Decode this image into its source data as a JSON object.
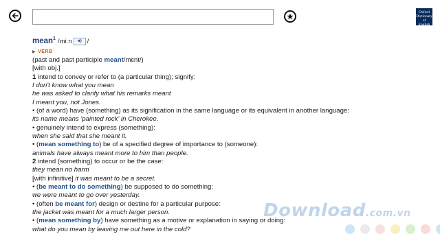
{
  "toolbar": {
    "back_icon": "back-arrow-icon",
    "favorite_icon": "star-icon",
    "search_value": "",
    "search_placeholder": ""
  },
  "logo": {
    "line1": "Oxford",
    "line2": "Dictionary of",
    "line3": "English"
  },
  "entry": {
    "headword": "mean",
    "homograph": "1",
    "pron_open": "/miːn",
    "pron_close": "/",
    "audio_icon": "speaker-icon",
    "pos": "VERB",
    "forms_pre": "(past and past participle ",
    "forms_word": "meant",
    "forms_post": "/mɛnt/)",
    "grammar": "[with obj.]",
    "l1_num": "1",
    "l1_text": " intend to convey or refer to (a particular thing); signify:",
    "l2": "I don't know what you mean",
    "l3": "he was asked to clarify what his remarks meant",
    "l4": "I meant you, not Jones.",
    "l5": "• (of a word) have (something) as its signification in the same language or its equivalent in another language:",
    "l6": "its name means 'painted rock' in Cherokee.",
    "l7": "• genuinely intend to express (something):",
    "l8": "when she said that she meant it.",
    "l9_pre": "• (",
    "l9_phrase": "mean something to",
    "l9_post": ") be of a specified degree of importance to (someone):",
    "l10": "animals have always meant more to him than people.",
    "l11_num": "2",
    "l11_text": " intend (something) to occur or be the case:",
    "l12": "they mean no harm",
    "l13_pre": "[with infinitive] ",
    "l13_ex": "it was meant to be a secret.",
    "l14_pre": "• (",
    "l14_phrase": "be meant to do something",
    "l14_post": ") be supposed to do something:",
    "l15": "we were meant to go over yesterday.",
    "l16_pre": "• (often ",
    "l16_phrase": "be meant for",
    "l16_post": ") design or destine for a particular purpose:",
    "l17": "the jacket was meant for a much larger person.",
    "l18_pre": "• (",
    "l18_phrase": "mean something by",
    "l18_post": ") have something as a motive or explanation in saying or doing:",
    "l19": "what do you mean by leaving me out here in the cold?"
  },
  "watermark": {
    "text": "Download",
    "suffix": ".com.vn",
    "dot_colors": [
      "#9fd3f0",
      "#d9d9d9",
      "#f6c6c6",
      "#f7e08a",
      "#b9e3a8",
      "#f5b9b9",
      "#9fd3f0"
    ]
  }
}
